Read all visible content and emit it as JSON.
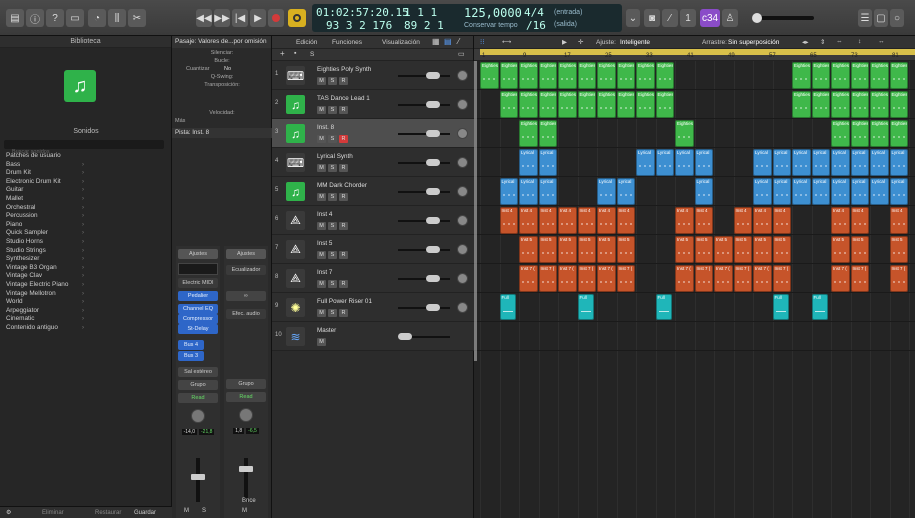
{
  "toolbar": {
    "library_icon": "library-icon",
    "info_icon": "info-icon",
    "help_icon": "help-icon",
    "toolbar_icon": "toolbar-icon",
    "smartcontrols_icon": "smart-controls-icon",
    "mixer_icon": "mixer-icon",
    "scissors_icon": "scissors-icon",
    "lcd": {
      "time": "01:02:57:20.15",
      "time_sub": "1  1  1",
      "bars": "93  3  2  176",
      "bars_sub": "89  2  1",
      "tempo": "125,0000",
      "tempo_label": "Conservar tempo",
      "sig_top": "4/4",
      "sig_bottom": "/16",
      "in_label": "(entrada)",
      "out_label": "(salida)"
    },
    "counter_badge": "c34"
  },
  "library": {
    "title": "Biblioteca",
    "sounds_title": "Sonidos",
    "search_placeholder": "Buscar sonidos",
    "items": [
      "Patches de usuario",
      "Bass",
      "Drum Kit",
      "Electronic Drum Kit",
      "Guitar",
      "Mallet",
      "Orchestral",
      "Percussion",
      "Piano",
      "Quick Sampler",
      "Studio Horns",
      "Studio Strings",
      "Synthesizer",
      "Vintage B3 Organ",
      "Vintage Clav",
      "Vintage Electric Piano",
      "Vintage Mellotron",
      "World",
      "Arpeggiator",
      "Cinematic",
      "Contenido antiguo"
    ],
    "footer_left": "Eliminar",
    "footer_mid": "Restaurar",
    "footer_right": "Guardar"
  },
  "inspector": {
    "region_header": "Pasaje: Valores de...por omisión",
    "rows": [
      "Silenciar:",
      "Bucle:",
      "Cuantizar",
      "Q-Swing:",
      "Transposición:",
      "Velocidad:"
    ],
    "quantize_value": "No",
    "mas": "Más",
    "track_header": "Pista: Inst. 8",
    "strip1": {
      "setting": "Ajustes",
      "instrument": "Electric MIDI",
      "pedal": "Pedalier",
      "eq": "Channel EQ",
      "comp": "Compressor",
      "delay": "St-Delay",
      "bus4": "Bus 4",
      "bus3": "Bus 3",
      "out": "Sal estéreo",
      "group": "Grupo",
      "read": "Read",
      "db1": "-14,0",
      "db2": "-21,8",
      "m": "M",
      "s": "S"
    },
    "strip2": {
      "setting": "Ajustes",
      "eq_label": "Ecualizador",
      "link": "∞",
      "audio_fx": "Efec. audio",
      "group": "Grupo",
      "read": "Read",
      "db1": "1,8",
      "db2": "-6,5",
      "m": "M",
      "name": "Bnce"
    }
  },
  "menu": {
    "edit": "Edición",
    "functions": "Funciones",
    "view": "Visualización",
    "snap_label": "Ajuste:",
    "snap_value": "Inteligente",
    "drag_label": "Arrastre:",
    "drag_value": "Sin superposición"
  },
  "tracks": [
    {
      "num": "1",
      "name": "Eighties Poly Synth",
      "icon": "synth-keyboard-icon",
      "mute": "M",
      "solo": "S",
      "rec": "R"
    },
    {
      "num": "2",
      "name": "TAS Dance Lead 1",
      "icon": "music-note-icon",
      "mute": "M",
      "solo": "S",
      "rec": "R"
    },
    {
      "num": "3",
      "name": "Inst. 8",
      "icon": "music-note-icon",
      "mute": "M",
      "solo": "S",
      "rec": "R"
    },
    {
      "num": "4",
      "name": "Lyrical Synth",
      "icon": "synth-keyboard-icon",
      "mute": "M",
      "solo": "S",
      "rec": "R"
    },
    {
      "num": "5",
      "name": "MM Dark Chorder",
      "icon": "music-note-icon",
      "mute": "M",
      "solo": "S",
      "rec": "R"
    },
    {
      "num": "6",
      "name": "Inst 4",
      "icon": "keyboard-stand-icon",
      "mute": "M",
      "solo": "S",
      "rec": "R"
    },
    {
      "num": "7",
      "name": "Inst 5",
      "icon": "keyboard-stand-icon",
      "mute": "M",
      "solo": "S",
      "rec": "R"
    },
    {
      "num": "8",
      "name": "Inst 7",
      "icon": "keyboard-stand-icon",
      "mute": "M",
      "solo": "S",
      "rec": "R"
    },
    {
      "num": "9",
      "name": "Full Power Riser 01",
      "icon": "sparkle-icon",
      "mute": "M",
      "solo": "S",
      "rec": "R"
    },
    {
      "num": "10",
      "name": "Master",
      "icon": "waveform-icon",
      "mute": "M",
      "solo": "",
      "rec": ""
    }
  ],
  "ruler": {
    "bars": [
      "1",
      "9",
      "17",
      "25",
      "33",
      "41",
      "49",
      "57",
      "65",
      "73",
      "81"
    ]
  },
  "colors": {
    "green": "#3fb84a",
    "blue": "#3d8fd1",
    "orange": "#c6542a",
    "cyan": "#1fb6b9",
    "cycle": "#d8c04a",
    "record": "#d33a3a"
  },
  "regions": {
    "lane1": {
      "label": "Eighties",
      "color": "green"
    },
    "lane2": {
      "label": "Eighties",
      "color": "green"
    },
    "lane3": {
      "label": "Eighties",
      "color": "green"
    },
    "lane4": {
      "label": "Lyrical",
      "color": "blue"
    },
    "lane5": {
      "label": "Lyrical",
      "color": "blue"
    },
    "lane6": {
      "label": "Inst 4",
      "color": "orange"
    },
    "lane7": {
      "label": "Inst 5",
      "color": "orange"
    },
    "lane8": {
      "label": "Inst 7 (",
      "color": "orange"
    },
    "lane9": {
      "label": "Full",
      "color": "cyan"
    }
  }
}
